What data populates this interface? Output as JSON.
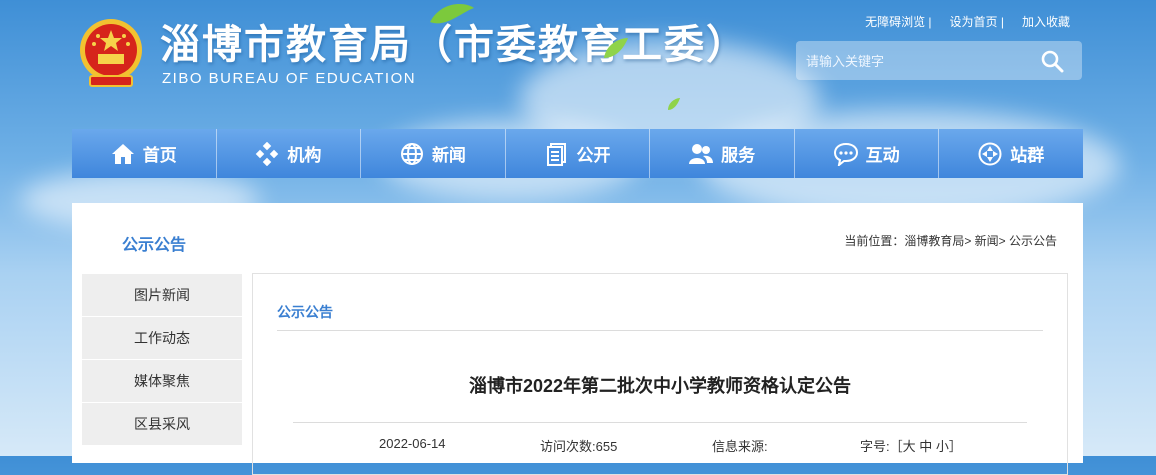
{
  "header": {
    "title": "淄博市教育局（市委教育工委）",
    "subtitle": "ZIBO BUREAU OF EDUCATION",
    "top_links": [
      "无障碍浏览 |",
      "设为首页 |",
      "加入收藏"
    ],
    "search_placeholder": "请输入关键字"
  },
  "nav": [
    {
      "label": "首页",
      "icon": "home-icon"
    },
    {
      "label": "机构",
      "icon": "diamond-grid-icon"
    },
    {
      "label": "新闻",
      "icon": "globe-icon"
    },
    {
      "label": "公开",
      "icon": "document-icon"
    },
    {
      "label": "服务",
      "icon": "users-icon"
    },
    {
      "label": "互动",
      "icon": "chat-icon"
    },
    {
      "label": "站群",
      "icon": "cluster-icon"
    }
  ],
  "main": {
    "section_title": "公示公告",
    "breadcrumb": "当前位置：淄博教育局> 新闻> 公示公告",
    "sidebar": [
      "图片新闻",
      "工作动态",
      "媒体聚焦",
      "区县采风"
    ],
    "content_head": "公示公告",
    "article_title": "淄博市2022年第二批次中小学教师资格认定公告",
    "meta": {
      "date": "2022-06-14",
      "views": "访问次数:655",
      "source": "信息来源:",
      "font_size": "字号:［大 中 小］"
    }
  },
  "colors": {
    "nav_top": "#6aa8ec",
    "nav_bottom": "#3f86dc",
    "accent": "#3a7fd1"
  }
}
